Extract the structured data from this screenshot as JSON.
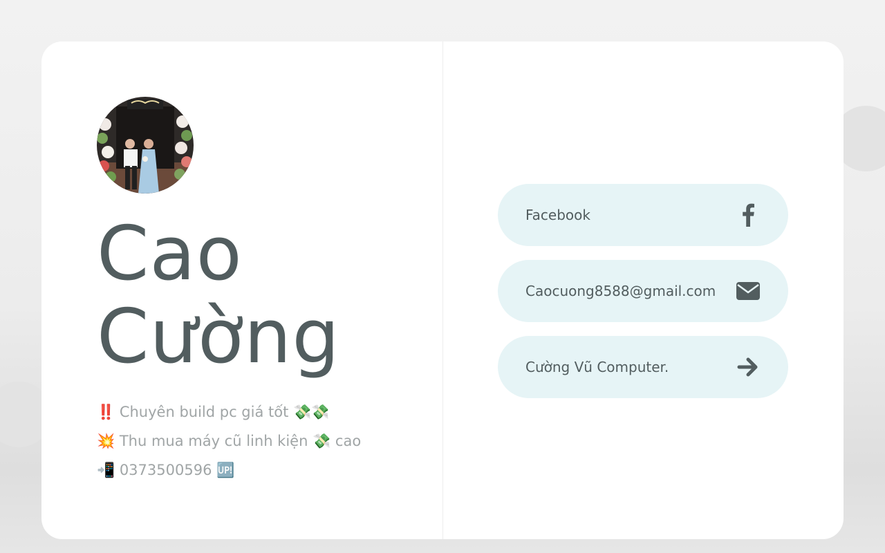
{
  "profile": {
    "name_line1": "Cao",
    "name_line2": "Cường",
    "bio": [
      "‼️ Chuyên build pc giá tốt 💸💸",
      "💥 Thu mua máy cũ linh kiện 💸 cao",
      "📲 0373500596 🆙"
    ]
  },
  "links": [
    {
      "label": "Facebook",
      "icon": "facebook-icon"
    },
    {
      "label": "Caocuong8588@gmail.com",
      "icon": "envelope-icon"
    },
    {
      "label": "Cường Vũ Computer.",
      "icon": "arrow-right-icon"
    }
  ],
  "colors": {
    "text": "#525d5f",
    "muted_text": "#a0a5a6",
    "link_background": "#e6f4f6",
    "card_background": "#ffffff",
    "page_background": "#f0f0f0"
  }
}
